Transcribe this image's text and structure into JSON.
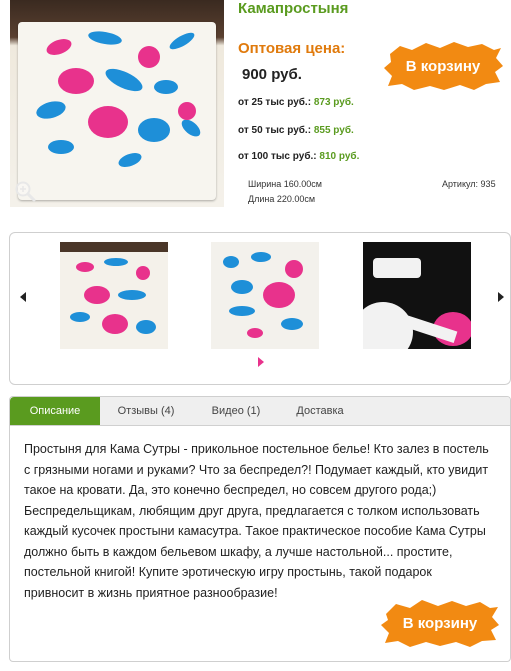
{
  "product": {
    "title": "Камапростыня",
    "price_label": "Оптовая цена:",
    "price": "900 руб.",
    "tiers": [
      {
        "label": "от 25 тыс руб.:",
        "price": "873 руб."
      },
      {
        "label": "от 50 тыс руб.:",
        "price": "855 руб."
      },
      {
        "label": "от 100 тыс руб.:",
        "price": "810 руб."
      }
    ],
    "width": "Ширина 160.00см",
    "length": "Длина 220.00см",
    "article": "Артикул: 935"
  },
  "buttons": {
    "add_to_cart_top": "В корзину",
    "add_to_cart_bottom": "В корзину"
  },
  "tabs": [
    {
      "label": "Описание"
    },
    {
      "label": "Отзывы (4)"
    },
    {
      "label": "Видео (1)"
    },
    {
      "label": "Доставка"
    }
  ],
  "description": "Простыня для Кама Сутры - прикольное постельное белье! Кто залез в постель с грязными ногами и руками? Что за беспредел?! Подумает каждый, кто увидит такое на кровати. Да, это конечно беспредел, но совсем другого рода;) Беспредельщикам, любящим друг друга, предлагается с толком использовать каждый кусочек простыни камасутра. Такое практическое пособие Кама Сутры должно быть в каждом бельевом шкафу, а лучше настольной... простите, постельной книгой! Купите эротическую игру простынь, такой подарок привносит в жизнь приятное разнообразие!",
  "colors": {
    "accent_green": "#5a9b1f",
    "accent_orange": "#e07a0c",
    "button_orange": "#f28a12",
    "print_blue": "#1e8fd8",
    "print_pink": "#e8328c"
  },
  "icons": {
    "zoom": "zoom-icon",
    "prev": "arrow-left-icon",
    "next": "arrow-right-icon",
    "pager": "pager-arrow-icon"
  }
}
